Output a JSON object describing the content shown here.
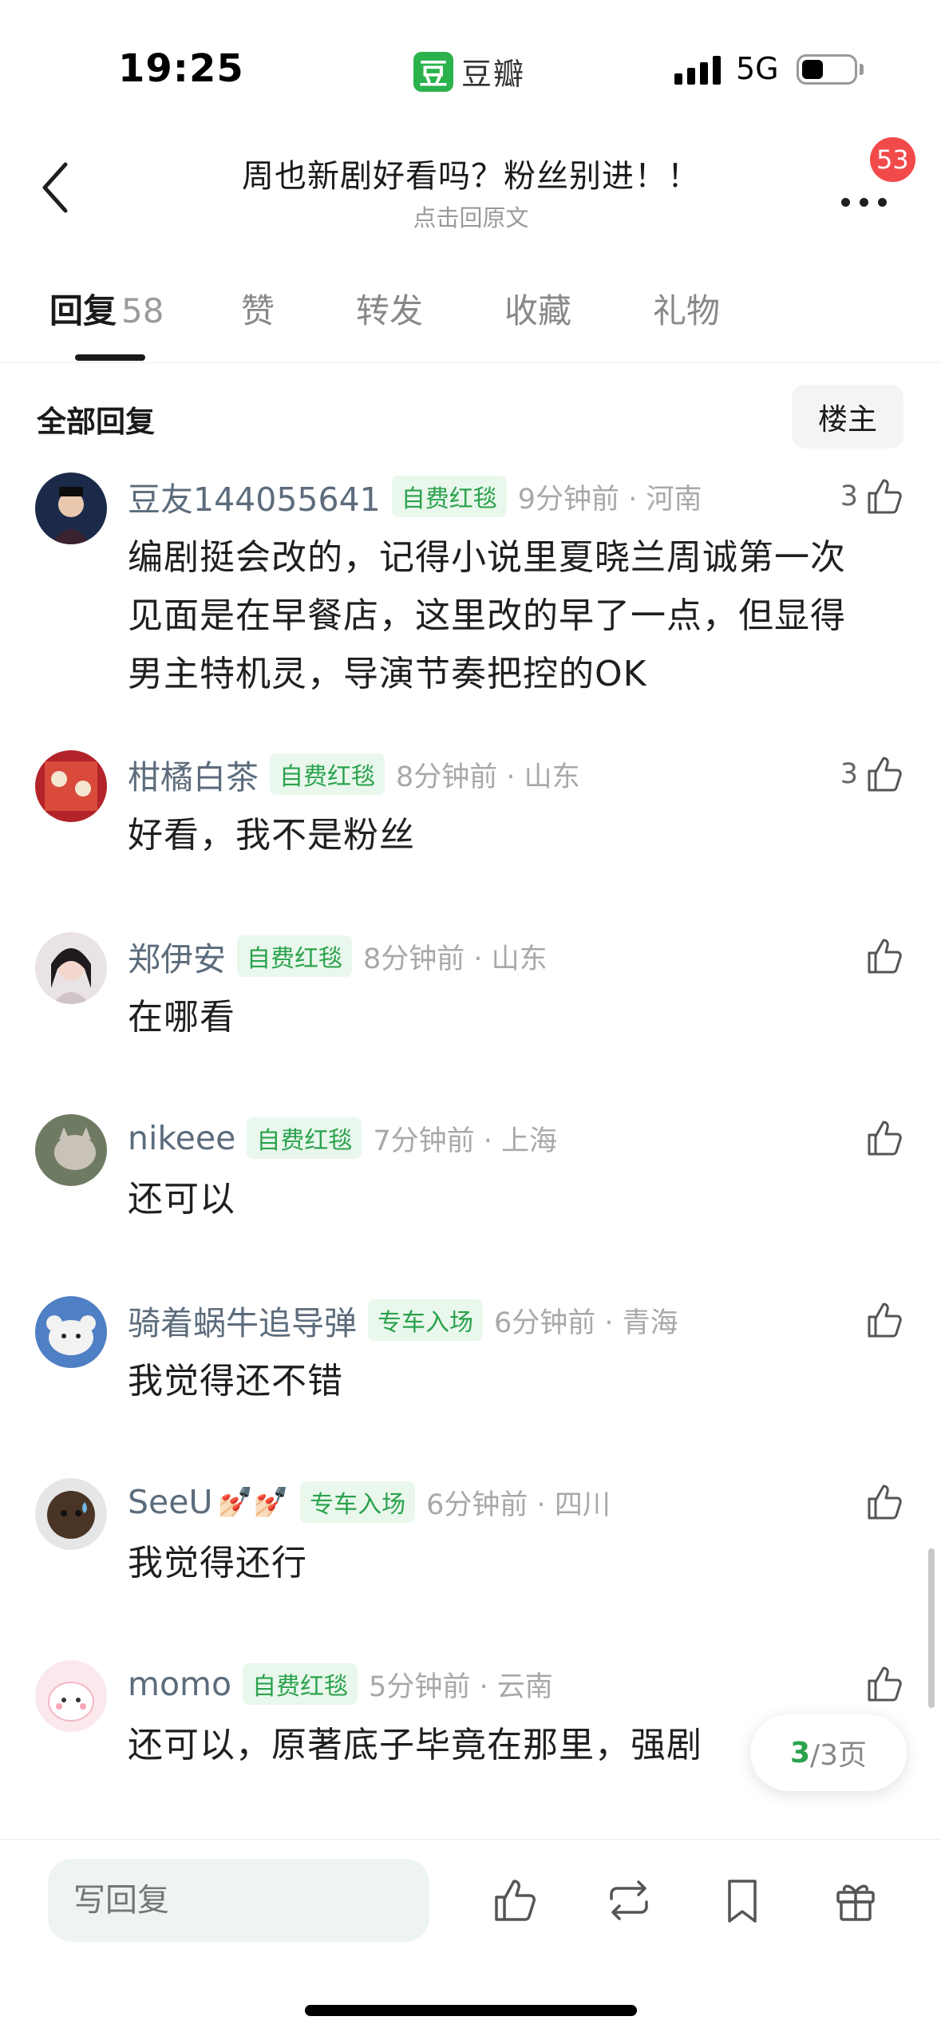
{
  "status_bar": {
    "time": "19:25",
    "app_logo_char": "豆",
    "app_name": "豆瓣",
    "network": "5G"
  },
  "header": {
    "title": "周也新剧好看吗？粉丝别进！！",
    "subtitle": "点击回原文",
    "notification_count": "53"
  },
  "tabs": [
    {
      "label": "回复",
      "count": "58",
      "active": true
    },
    {
      "label": "赞"
    },
    {
      "label": "转发"
    },
    {
      "label": "收藏"
    },
    {
      "label": "礼物"
    }
  ],
  "filter": {
    "all_replies": "全部回复",
    "op_only": "楼主"
  },
  "comments": [
    {
      "username": "豆友144055641",
      "badge": "自费红毯",
      "time": "9分钟前",
      "location": "河南",
      "likes": "3",
      "text": "编剧挺会改的，记得小说里夏晓兰周诚第一次见面是在早餐店，这里改的早了一点，但显得男主特机灵，导演节奏把控的OK"
    },
    {
      "username": "柑橘白茶",
      "badge": "自费红毯",
      "time": "8分钟前",
      "location": "山东",
      "likes": "3",
      "text": "好看，我不是粉丝"
    },
    {
      "username": "郑伊安",
      "badge": "自费红毯",
      "time": "8分钟前",
      "location": "山东",
      "likes": "",
      "text": "在哪看"
    },
    {
      "username": "nikeee",
      "badge": "自费红毯",
      "time": "7分钟前",
      "location": "上海",
      "likes": "",
      "text": "还可以"
    },
    {
      "username": "骑着蜗牛追导弹",
      "badge": "专车入场",
      "time": "6分钟前",
      "location": "青海",
      "likes": "",
      "text": "我觉得还不错"
    },
    {
      "username": "SeeU",
      "emoji": "💅🏻💅🏻",
      "badge": "专车入场",
      "time": "6分钟前",
      "location": "四川",
      "likes": "",
      "text": "我觉得还行"
    },
    {
      "username": "momo",
      "badge": "自费红毯",
      "time": "5分钟前",
      "location": "云南",
      "likes": "",
      "text": "还可以，原著底子毕竟在那里，强剧"
    }
  ],
  "pagination": {
    "current": "3",
    "total": "/3页"
  },
  "bottom_bar": {
    "reply_placeholder": "写回复"
  },
  "colors": {
    "brand_green": "#2bb24c",
    "badge_bg": "#e9f7ec",
    "badge_text": "#2ba24d",
    "notification_red": "#f24a4a",
    "username": "#5c6c7c"
  },
  "icons": [
    "back-icon",
    "more-icon",
    "thumb-up-icon",
    "repost-icon",
    "bookmark-icon",
    "gift-icon"
  ]
}
